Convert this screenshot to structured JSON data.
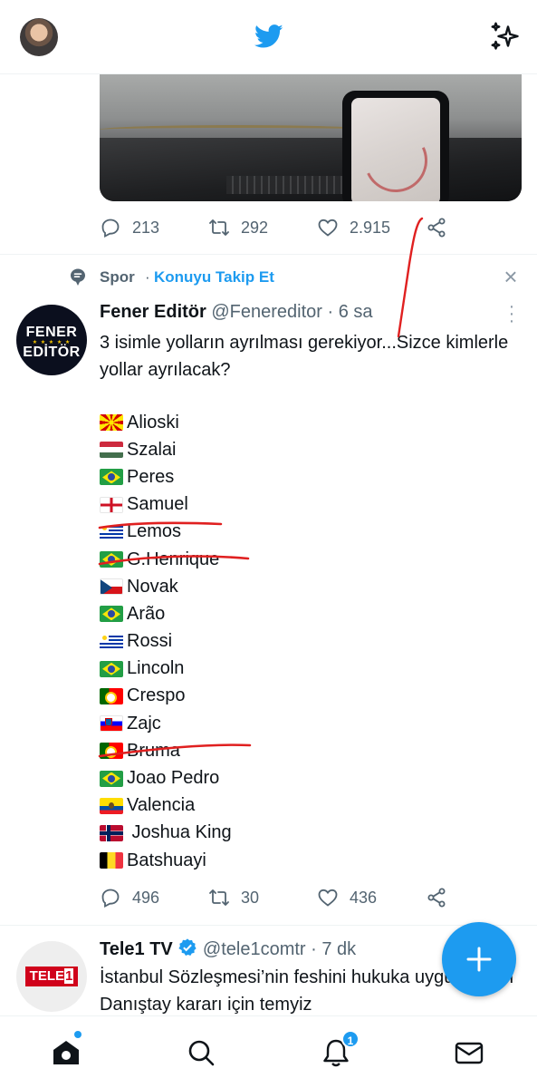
{
  "colors": {
    "accent": "#1d9bf0",
    "text": "#0f1419",
    "muted": "#536471",
    "annotation_red": "#e02020"
  },
  "topbar": {
    "logo_icon": "twitter-bird-icon",
    "right_icon": "sparkle-icon"
  },
  "prev_tweet": {
    "replies": "213",
    "retweets": "292",
    "likes": "2.915"
  },
  "topic": {
    "name": "Spor",
    "separator": "·",
    "follow_label": "Konuyu Takip Et"
  },
  "tweet": {
    "avatar_text_1": "FENER",
    "avatar_text_2": "EDİTÖR",
    "name": "Fener Editör",
    "handle": "@Fenereditor",
    "separator": "·",
    "time": "6 sa",
    "text": "3 isimle yolların ayrılması gerekiyor...Sizce kimlerle yollar ayrılacak?",
    "players": [
      {
        "flag": "mk",
        "name": "Alioski"
      },
      {
        "flag": "hu",
        "name": "Szalai"
      },
      {
        "flag": "br",
        "name": "Peres"
      },
      {
        "flag": "en",
        "name": "Samuel"
      },
      {
        "flag": "uy",
        "name": "Lemos"
      },
      {
        "flag": "br",
        "name": "G.Henrique"
      },
      {
        "flag": "cz",
        "name": "Novak"
      },
      {
        "flag": "br",
        "name": "Arão"
      },
      {
        "flag": "uy",
        "name": "Rossi"
      },
      {
        "flag": "br",
        "name": "Lincoln"
      },
      {
        "flag": "pt",
        "name": "Crespo"
      },
      {
        "flag": "si",
        "name": "Zajc"
      },
      {
        "flag": "pt",
        "name": "Bruma"
      },
      {
        "flag": "br",
        "name": "Joao Pedro"
      },
      {
        "flag": "ec",
        "name": "Valencia"
      },
      {
        "flag": "no",
        "name": " Joshua King"
      },
      {
        "flag": "be",
        "name": "Batshuayi"
      }
    ],
    "replies": "496",
    "retweets": "30",
    "likes": "436"
  },
  "next_tweet": {
    "logo_text_1": "TELE",
    "logo_text_2": "1",
    "name": "Tele1 TV",
    "handle": "@tele1comtr",
    "separator": "·",
    "time": "7 dk",
    "text": "İstanbul Sözleşmesi’nin feshini hukuka uygun bulan Danıştay kararı için temyiz"
  },
  "bottom_nav": {
    "notifications_count": "1"
  }
}
